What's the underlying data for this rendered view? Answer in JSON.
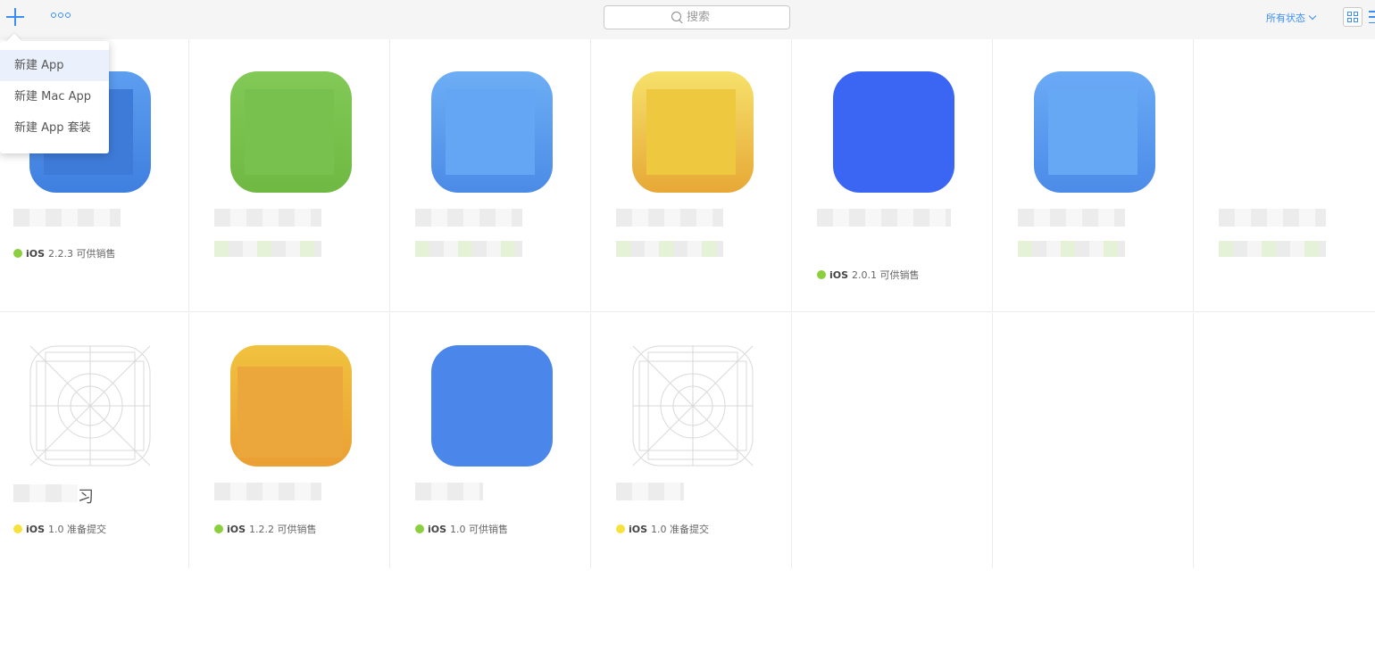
{
  "toolbar": {
    "search_placeholder": "搜索",
    "status_filter": "所有状态"
  },
  "menu": {
    "items": [
      {
        "label": "新建 App"
      },
      {
        "label": "新建 Mac App"
      },
      {
        "label": "新建 App 套装"
      }
    ]
  },
  "apps": [
    {
      "name": "",
      "status_platform": "iOS",
      "status_version": "2.2.3",
      "status_text": "可供销售",
      "status_color": "#8bcf3e",
      "icon_color": "#4a8be8"
    },
    {
      "name": "",
      "status_platform": "",
      "status_version": "",
      "status_text": "",
      "icon_color": "#7ac352"
    },
    {
      "name": "",
      "status_platform": "",
      "status_version": "",
      "status_text": "",
      "icon_color": "#5aa3f2"
    },
    {
      "name": "",
      "status_platform": "",
      "status_version": "",
      "status_text": "",
      "icon_color": "#f0cb3b"
    },
    {
      "name": "",
      "status_platform": "iOS",
      "status_version": "2.0.1",
      "status_text": "可供销售",
      "status_color": "#8bcf3e",
      "icon_color": "#3a65f3"
    },
    {
      "name": "",
      "status_platform": "",
      "status_version": "",
      "status_text": "",
      "icon_color": "#5e9ff0"
    },
    {
      "name": "",
      "status_platform": "",
      "status_version": "",
      "status_text": ""
    },
    {
      "name": "习",
      "status_platform": "iOS",
      "status_version": "1.0",
      "status_text": "准备提交",
      "status_color": "#f5e23b"
    },
    {
      "name": "",
      "status_platform": "iOS",
      "status_version": "1.2.2",
      "status_text": "可供销售",
      "status_color": "#8bcf3e",
      "icon_color": "#eba93a"
    },
    {
      "name": "",
      "status_platform": "iOS",
      "status_version": "1.0",
      "status_text": "可供销售",
      "status_color": "#8bcf3e",
      "icon_color": "#4a86ea"
    },
    {
      "name": "",
      "status_platform": "iOS",
      "status_version": "1.0",
      "status_text": "准备提交",
      "status_color": "#f5e23b"
    }
  ]
}
